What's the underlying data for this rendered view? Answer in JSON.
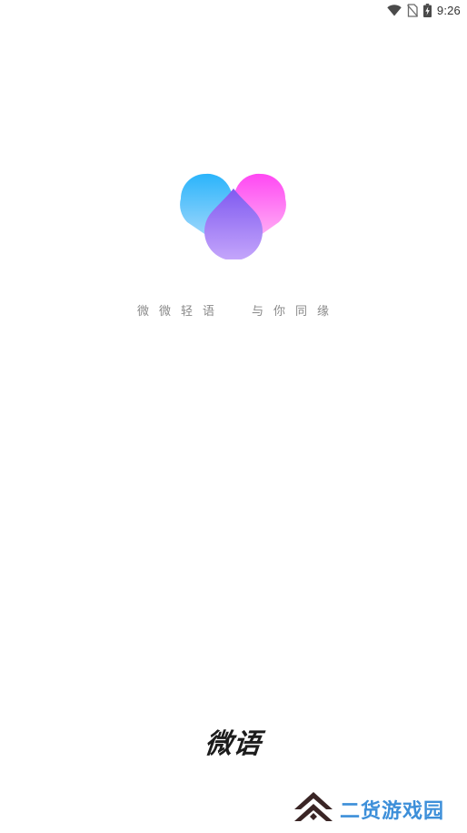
{
  "status_bar": {
    "time": "9:26",
    "icons": [
      "wifi-icon",
      "no-sim-icon",
      "battery-charging-icon"
    ]
  },
  "logo": {
    "icon": "heart-droplets-logo",
    "colors": {
      "left_drop": "#29b6f6",
      "right_drop": "#ff4df5",
      "center_drop": "#8f6bf7"
    }
  },
  "slogan": {
    "left": "微微轻语",
    "right": "与你同缘"
  },
  "app_name": "微语",
  "watermark": {
    "text": "二货游戏园",
    "icon": "double-chevron-up-icon",
    "colors": {
      "icon": "#3a2525",
      "text": "#3d8fd9"
    }
  }
}
